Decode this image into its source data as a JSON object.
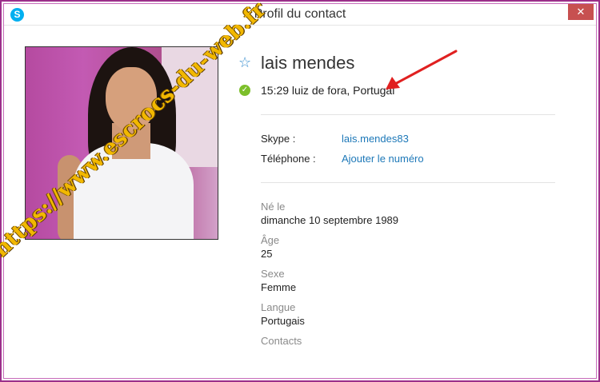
{
  "window": {
    "title": "Profil du contact",
    "close": "✕"
  },
  "watermark": "https://www.escrocs-du-web.fr",
  "profile": {
    "name": "lais mendes",
    "location": "15:29 luiz de fora, Portugal"
  },
  "contact": {
    "skype_label": "Skype :",
    "skype_value": "lais.mendes83",
    "phone_label": "Téléphone :",
    "phone_value": "Ajouter le numéro"
  },
  "details": [
    {
      "label": "Né le",
      "value": "dimanche 10 septembre 1989"
    },
    {
      "label": "Âge",
      "value": "25"
    },
    {
      "label": "Sexe",
      "value": "Femme"
    },
    {
      "label": "Langue",
      "value": "Portugais"
    },
    {
      "label": "Contacts",
      "value": ""
    }
  ],
  "colors": {
    "accent": "#1d78b8",
    "status_online": "#7cbf2a",
    "frame": "#9b2f8a",
    "arrow": "#e02020"
  },
  "icons": [
    "skype-icon",
    "close-icon",
    "star-icon",
    "online-status-icon"
  ]
}
